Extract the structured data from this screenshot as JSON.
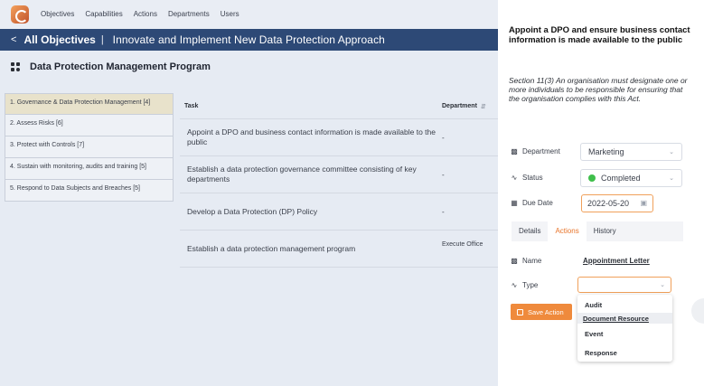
{
  "nav": {
    "items": [
      "Objectives",
      "Capabilities",
      "Actions",
      "Departments",
      "Users"
    ]
  },
  "header": {
    "back_label": "All Objectives",
    "separator": "|",
    "title": "Innovate and Implement New Data Protection Approach"
  },
  "program": {
    "title": "Data Protection Management Program"
  },
  "sidebar": {
    "items": [
      "1. Governance & Data Protection Management [4]",
      "2. Assess Risks [6]",
      "3. Protect with Controls [7]",
      "4. Sustain with monitoring, audits and training [5]",
      "5. Respond to Data Subjects and Breaches [5]"
    ]
  },
  "table": {
    "headers": {
      "task": "Task",
      "department": "Department"
    },
    "rows": [
      {
        "task": "Appoint a DPO and business contact information is made available to the public",
        "department": "-"
      },
      {
        "task": "Establish a data protection governance committee consisting of key departments",
        "department": "-"
      },
      {
        "task": "Develop a Data Protection (DP) Policy",
        "department": "-"
      },
      {
        "task": "Establish a data protection management program",
        "department": "Execute Office"
      }
    ]
  },
  "panel": {
    "title": "Appoint a DPO and ensure business contact information is made available to the public",
    "description": "Section 11(3)  An organisation must designate one or more individuals to be responsible for ensuring that the organisation complies with this Act.",
    "department_label": "Department",
    "department_value": "Marketing",
    "status_label": "Status",
    "status_value": "Completed",
    "status_color": "#3fbf4b",
    "due_label": "Due Date",
    "due_value": "2022-05-20",
    "tabs": [
      "Details",
      "Actions",
      "History"
    ],
    "active_tab": "Actions",
    "name_label": "Name",
    "name_value": "Appointment Letter",
    "type_label": "Type",
    "type_value": "",
    "save_label": "Save Action",
    "type_options": [
      "Audit",
      "Document Resource",
      "Event",
      "Response"
    ],
    "accent_color": "#ef8a3c",
    "brand_color": "#2d4976"
  }
}
